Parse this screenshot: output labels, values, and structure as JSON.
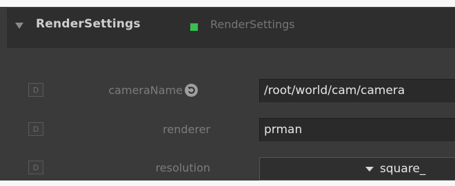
{
  "node": {
    "title": "RenderSettings",
    "type_label": "RenderSettings",
    "status_color": "#38c050",
    "collapse_icon": "triangle-down-icon"
  },
  "params": [
    {
      "lock_label": "D",
      "label": "cameraName",
      "value": "/root/world/cam/camera",
      "has_reset": true,
      "reset_icon": "reset-icon"
    },
    {
      "lock_label": "D",
      "label": "renderer",
      "value": "prman",
      "has_reset": false
    },
    {
      "lock_label": "D",
      "label": "resolution",
      "value": "square_",
      "widget": "dropdown"
    }
  ]
}
